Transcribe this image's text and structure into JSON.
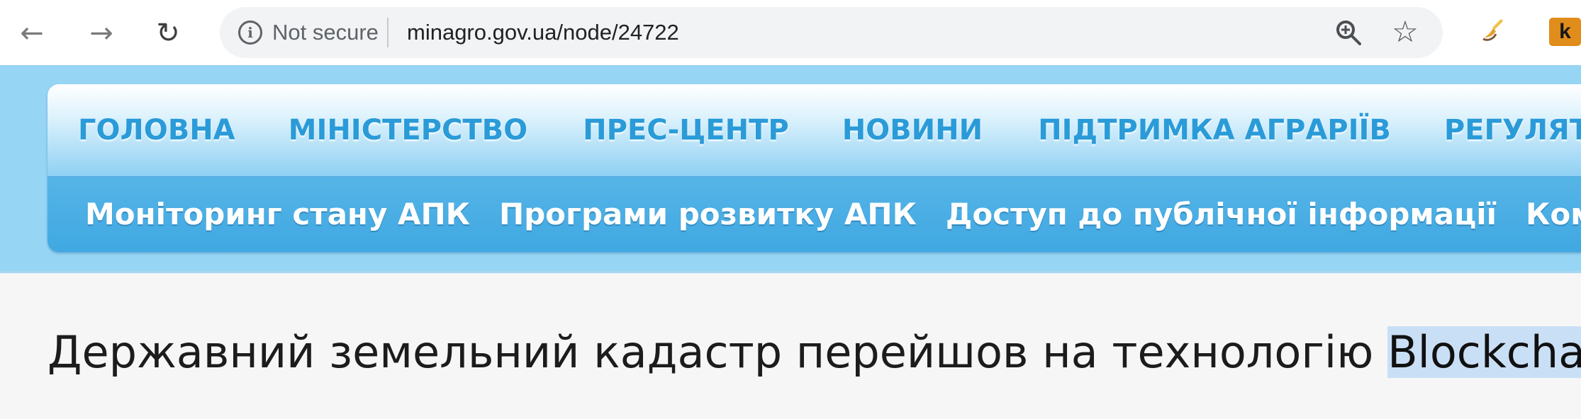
{
  "browser": {
    "back_label": "←",
    "forward_label": "→",
    "reload_label": "↻",
    "security_status": "Not secure",
    "url": "minagro.gov.ua/node/24722",
    "icons": {
      "info": "info-circle-icon",
      "zoom": "zoom-in-icon",
      "star": "star-icon",
      "extension": "paint-extension-icon",
      "k_extension": "k-extension-icon"
    },
    "k_extension_label": "k"
  },
  "site": {
    "main_menu": [
      "ГОЛОВНА",
      "МІНІСТЕРСТВО",
      "ПРЕС-ЦЕНТР",
      "НОВИНИ",
      "ПІДТРИМКА АГРАРІЇВ",
      "РЕГУЛЯТОР"
    ],
    "secondary_menu": [
      "Моніторинг стану АПК",
      "Програми розвитку АПК",
      "Доступ до публічної інформації",
      "Кому"
    ]
  },
  "article": {
    "title_prefix": "Державний земельний кадастр перейшов на технологію ",
    "title_highlight": "Blockchain"
  },
  "colors": {
    "header_background": "#97d5f5",
    "menu_text": "#2a9bd8",
    "secondary_menu_text": "#ffffff",
    "highlight": "#c9dff5"
  }
}
